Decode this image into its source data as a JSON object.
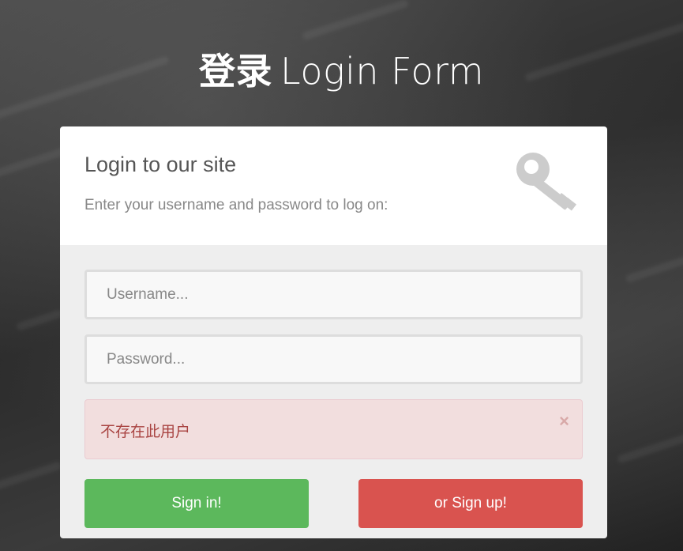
{
  "header": {
    "title_strong": "登录",
    "title_rest": "Login Form"
  },
  "card": {
    "heading": "Login to our site",
    "subheading": "Enter your username and password to log on:",
    "icon": "key-icon"
  },
  "form": {
    "username": {
      "value": "",
      "placeholder": "Username..."
    },
    "password": {
      "value": "",
      "placeholder": "Password..."
    }
  },
  "alert": {
    "message": "不存在此用户",
    "close_symbol": "×"
  },
  "buttons": {
    "signin_label": "Sign in!",
    "signup_label": "or Sign up!"
  },
  "colors": {
    "signin": "#5cb85c",
    "signup": "#d9534f",
    "alert_bg": "#f2dede",
    "alert_text": "#a94442"
  }
}
